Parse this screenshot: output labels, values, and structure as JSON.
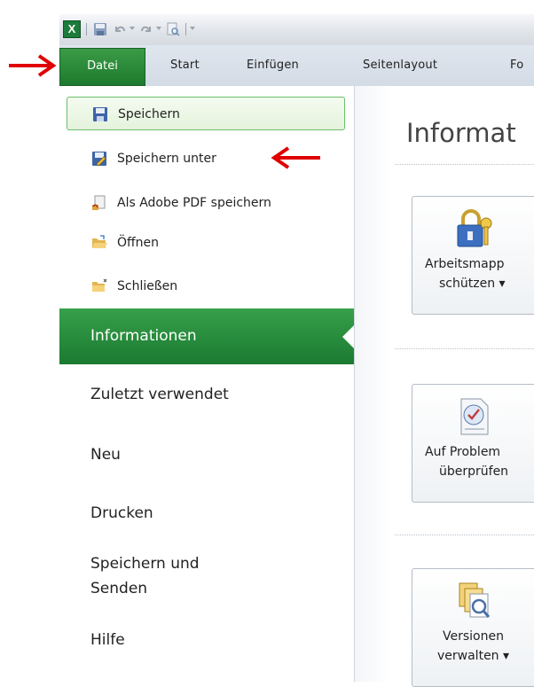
{
  "ribbon": {
    "tabs": [
      "Datei",
      "Start",
      "Einfügen",
      "Seitenlayout",
      "Fo"
    ]
  },
  "backstage": {
    "commands": [
      {
        "label": "Speichern",
        "icon": "save-icon"
      },
      {
        "label": "Speichern unter",
        "icon": "save-as-icon"
      },
      {
        "label": "Als Adobe PDF speichern",
        "icon": "pdf-icon"
      },
      {
        "label": "Öffnen",
        "icon": "open-folder-icon"
      },
      {
        "label": "Schließen",
        "icon": "close-folder-icon"
      }
    ],
    "nav": [
      "Informationen",
      "Zuletzt verwendet",
      "Neu",
      "Drucken",
      "Speichern und",
      "Senden",
      "Hilfe"
    ]
  },
  "info_pane": {
    "heading": "Informat",
    "buttons": [
      {
        "line1": "Arbeitsmapp",
        "line2": "schützen ▾",
        "icon": "lock-key-icon"
      },
      {
        "line1": "Auf Problem",
        "line2": "überprüfen",
        "icon": "checklist-icon"
      },
      {
        "line1": "Versionen",
        "line2": "verwalten ▾",
        "icon": "versions-icon"
      }
    ]
  },
  "colors": {
    "file_tab": "#1e7a2f",
    "selected_nav": "#2a8c3c",
    "annotation_arrow": "#e00000"
  }
}
